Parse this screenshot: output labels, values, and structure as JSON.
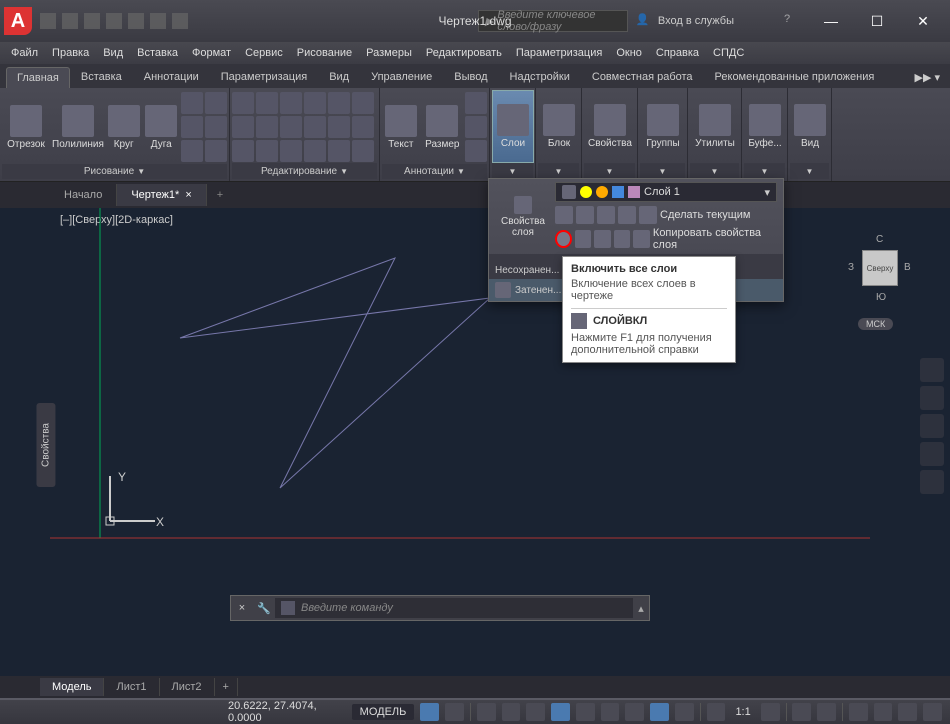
{
  "title": "Чертеж1.dwg",
  "search_placeholder": "Введите ключевое слово/фразу",
  "signin": "Вход в службы",
  "menus": [
    "Файл",
    "Правка",
    "Вид",
    "Вставка",
    "Формат",
    "Сервис",
    "Рисование",
    "Размеры",
    "Редактировать",
    "Параметризация",
    "Окно",
    "Справка",
    "СПДС"
  ],
  "ribbon_tabs": [
    "Главная",
    "Вставка",
    "Аннотации",
    "Параметризация",
    "Вид",
    "Управление",
    "Вывод",
    "Надстройки",
    "Совместная работа",
    "Рекомендованные приложения"
  ],
  "active_ribbon_tab": "Главная",
  "panels": {
    "draw": {
      "label": "Рисование",
      "items": [
        "Отрезок",
        "Полилиния",
        "Круг",
        "Дуга"
      ]
    },
    "edit": {
      "label": "Редактирование"
    },
    "annot": {
      "label": "Аннотации",
      "items": [
        "Текст",
        "Размер"
      ]
    },
    "layers": {
      "label": "Слои"
    },
    "block": {
      "label": "Блок"
    },
    "props": {
      "label": "Свойства"
    },
    "groups": {
      "label": "Группы"
    },
    "utils": {
      "label": "Утилиты"
    },
    "clip": {
      "label": "Буфе..."
    },
    "view": {
      "label": "Вид"
    }
  },
  "doctabs": {
    "start": "Начало",
    "current": "Чертеж1*"
  },
  "viewport_label": "[–][Сверху][2D-каркас]",
  "side_label": "Свойства",
  "viewcube": {
    "top": "Сверху",
    "n": "С",
    "s": "Ю",
    "w": "З",
    "e": "В",
    "wcs": "МСК"
  },
  "layers_dropdown": {
    "properties_label": "Свойства слоя",
    "current_layer": "Слой 1",
    "make_current": "Сделать текущим",
    "copy_props": "Копировать свойства слоя",
    "unsaved": "Несохранен...",
    "shaded": "Затенен..."
  },
  "tooltip": {
    "title": "Включить все слои",
    "desc": "Включение всех слоев в чертеже",
    "command": "СЛОЙВКЛ",
    "help": "Нажмите F1 для получения дополнительной справки"
  },
  "cmdline_placeholder": "Введите команду",
  "bottom_tabs": [
    "Модель",
    "Лист1",
    "Лист2"
  ],
  "statusbar": {
    "coords": "20.6222, 27.4074, 0.0000",
    "model": "МОДЕЛЬ",
    "ratio": "1:1"
  },
  "ucs": {
    "x": "X",
    "y": "Y"
  }
}
